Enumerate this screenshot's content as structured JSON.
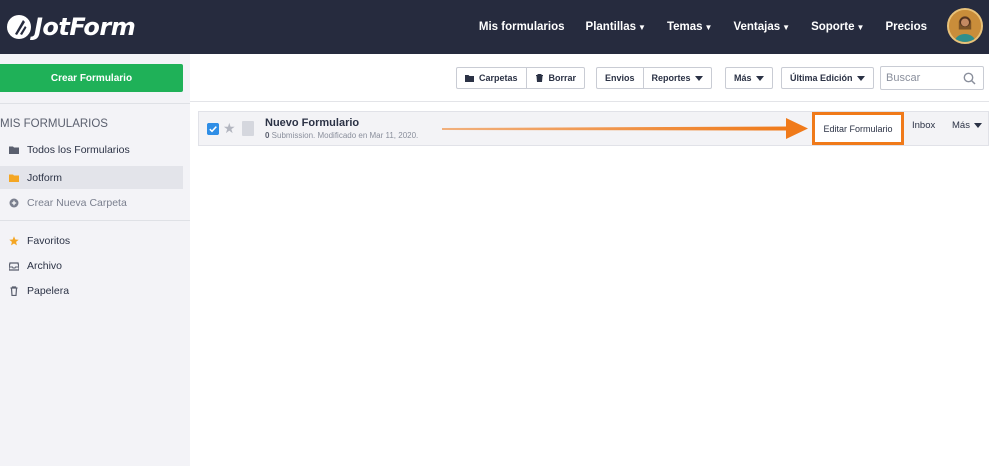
{
  "brand": {
    "logo_text": "JotForm"
  },
  "nav": {
    "items": [
      {
        "label": "Mis formularios",
        "caret": false
      },
      {
        "label": "Plantillas",
        "caret": true
      },
      {
        "label": "Temas",
        "caret": true
      },
      {
        "label": "Ventajas",
        "caret": true
      },
      {
        "label": "Soporte",
        "caret": true
      },
      {
        "label": "Precios",
        "caret": false
      }
    ]
  },
  "sidebar": {
    "create_label": "Crear Formulario",
    "title": "MIS FORMULARIOS",
    "items": [
      {
        "label": "Todos los Formularios",
        "icon": "folder-icon"
      },
      {
        "label": "Jotform",
        "icon": "folder-icon"
      },
      {
        "label": "Crear Nueva Carpeta",
        "icon": "plus-circle-icon"
      }
    ],
    "secondary": [
      {
        "label": "Favoritos",
        "icon": "star-icon"
      },
      {
        "label": "Archivo",
        "icon": "archive-icon"
      },
      {
        "label": "Papelera",
        "icon": "trash-icon"
      }
    ]
  },
  "toolbar": {
    "carpetas": "Carpetas",
    "borrar": "Borrar",
    "envios": "Envios",
    "reportes": "Reportes",
    "mas": "Más",
    "ultima_edicion": "Última Edición",
    "search_placeholder": "Buscar"
  },
  "form": {
    "name": "Nuevo Formulario",
    "submissions": "0",
    "meta_rest": " Submission. Modificado en Mar 11, 2020.",
    "edit_label": "Editar Formulario",
    "inbox_label": "Inbox",
    "more_label": "Más"
  },
  "colors": {
    "topbar": "#262b3e",
    "create_button": "#1fb158",
    "highlight": "#f07a1a",
    "checkbox": "#2f8ee6",
    "folder_accent": "#f4a623"
  }
}
